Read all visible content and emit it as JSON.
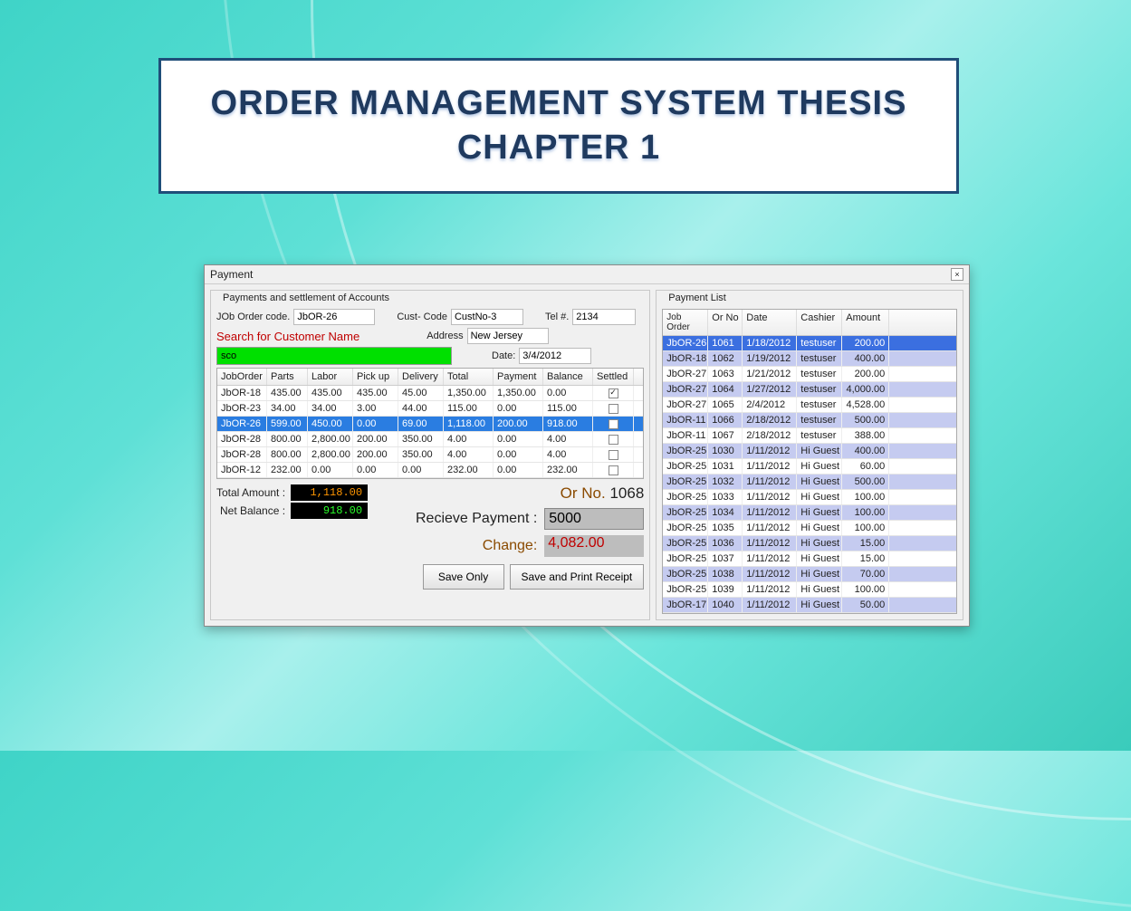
{
  "title": {
    "line1": "ORDER MANAGEMENT SYSTEM THESIS",
    "line2": "CHAPTER 1"
  },
  "window": {
    "title": "Payment"
  },
  "panel": {
    "legend": "Payments and settlement of Accounts",
    "labels": {
      "jobOrderCode": "JOb Order code.",
      "custCode": "Cust- Code",
      "tel": "Tel #.",
      "search": "Search for Customer Name",
      "address": "Address",
      "date": "Date:"
    },
    "values": {
      "jobOrderCode": "JbOR-26",
      "custCode": "CustNo-3",
      "tel": "2134",
      "search": "sco",
      "address": "New Jersey",
      "date": "3/4/2012"
    }
  },
  "grid1": {
    "headers": [
      "JobOrder",
      "Parts",
      "Labor",
      "Pick up",
      "Delivery",
      "Total",
      "Payment",
      "Balance",
      "Settled"
    ],
    "rows": [
      {
        "c": [
          "JbOR-18",
          "435.00",
          "435.00",
          "435.00",
          "45.00",
          "1,350.00",
          "1,350.00",
          "0.00"
        ],
        "settled": true,
        "sel": false
      },
      {
        "c": [
          "JbOR-23",
          "34.00",
          "34.00",
          "3.00",
          "44.00",
          "115.00",
          "0.00",
          "115.00"
        ],
        "settled": false,
        "sel": false
      },
      {
        "c": [
          "JbOR-26",
          "599.00",
          "450.00",
          "0.00",
          "69.00",
          "1,118.00",
          "200.00",
          "918.00"
        ],
        "settled": false,
        "sel": true
      },
      {
        "c": [
          "JbOR-28",
          "800.00",
          "2,800.00",
          "200.00",
          "350.00",
          "4.00",
          "0.00",
          "4.00"
        ],
        "settled": false,
        "sel": false
      },
      {
        "c": [
          "JbOR-28",
          "800.00",
          "2,800.00",
          "200.00",
          "350.00",
          "4.00",
          "0.00",
          "4.00"
        ],
        "settled": false,
        "sel": false
      },
      {
        "c": [
          "JbOR-12",
          "232.00",
          "0.00",
          "0.00",
          "0.00",
          "232.00",
          "0.00",
          "232.00"
        ],
        "settled": false,
        "sel": false
      }
    ]
  },
  "totals": {
    "totalAmountLabel": "Total Amount :",
    "totalAmount": "1,118.00",
    "netBalanceLabel": "Net Balance :",
    "netBalance": "918.00",
    "orNoLabel": "Or No.",
    "orNo": "1068",
    "recvLabel": "Recieve Payment :",
    "recv": "5000",
    "changeLabel": "Change:",
    "change": "4,082.00"
  },
  "buttons": {
    "saveOnly": "Save Only",
    "savePrint": "Save and Print Receipt"
  },
  "paymentList": {
    "legend": "Payment List",
    "headers": [
      "Job Order",
      "Or No",
      "Date",
      "Cashier",
      "Amount"
    ],
    "rows": [
      {
        "c": [
          "JbOR-26",
          "1061",
          "1/18/2012",
          "testuser",
          "200.00"
        ],
        "hl": true
      },
      {
        "c": [
          "JbOR-18",
          "1062",
          "1/19/2012",
          "testuser",
          "400.00"
        ],
        "alt": true
      },
      {
        "c": [
          "JbOR-27",
          "1063",
          "1/21/2012",
          "testuser",
          "200.00"
        ]
      },
      {
        "c": [
          "JbOR-27",
          "1064",
          "1/27/2012",
          "testuser",
          "4,000.00"
        ],
        "alt": true
      },
      {
        "c": [
          "JbOR-27",
          "1065",
          "2/4/2012",
          "testuser",
          "4,528.00"
        ]
      },
      {
        "c": [
          "JbOR-11",
          "1066",
          "2/18/2012",
          "testuser",
          "500.00"
        ],
        "alt": true
      },
      {
        "c": [
          "JbOR-11",
          "1067",
          "2/18/2012",
          "testuser",
          "388.00"
        ]
      },
      {
        "c": [
          "JbOR-25",
          "1030",
          "1/11/2012",
          "Hi Guest",
          "400.00"
        ],
        "alt": true
      },
      {
        "c": [
          "JbOR-25",
          "1031",
          "1/11/2012",
          "Hi Guest",
          "60.00"
        ]
      },
      {
        "c": [
          "JbOR-25",
          "1032",
          "1/11/2012",
          "Hi Guest",
          "500.00"
        ],
        "alt": true
      },
      {
        "c": [
          "JbOR-25",
          "1033",
          "1/11/2012",
          "Hi Guest",
          "100.00"
        ]
      },
      {
        "c": [
          "JbOR-25",
          "1034",
          "1/11/2012",
          "Hi Guest",
          "100.00"
        ],
        "alt": true
      },
      {
        "c": [
          "JbOR-25",
          "1035",
          "1/11/2012",
          "Hi Guest",
          "100.00"
        ]
      },
      {
        "c": [
          "JbOR-25",
          "1036",
          "1/11/2012",
          "Hi Guest",
          "15.00"
        ],
        "alt": true
      },
      {
        "c": [
          "JbOR-25",
          "1037",
          "1/11/2012",
          "Hi Guest",
          "15.00"
        ]
      },
      {
        "c": [
          "JbOR-25",
          "1038",
          "1/11/2012",
          "Hi Guest",
          "70.00"
        ],
        "alt": true
      },
      {
        "c": [
          "JbOR-25",
          "1039",
          "1/11/2012",
          "Hi Guest",
          "100.00"
        ]
      },
      {
        "c": [
          "JbOR-17",
          "1040",
          "1/11/2012",
          "Hi Guest",
          "50.00"
        ],
        "alt": true
      }
    ]
  }
}
